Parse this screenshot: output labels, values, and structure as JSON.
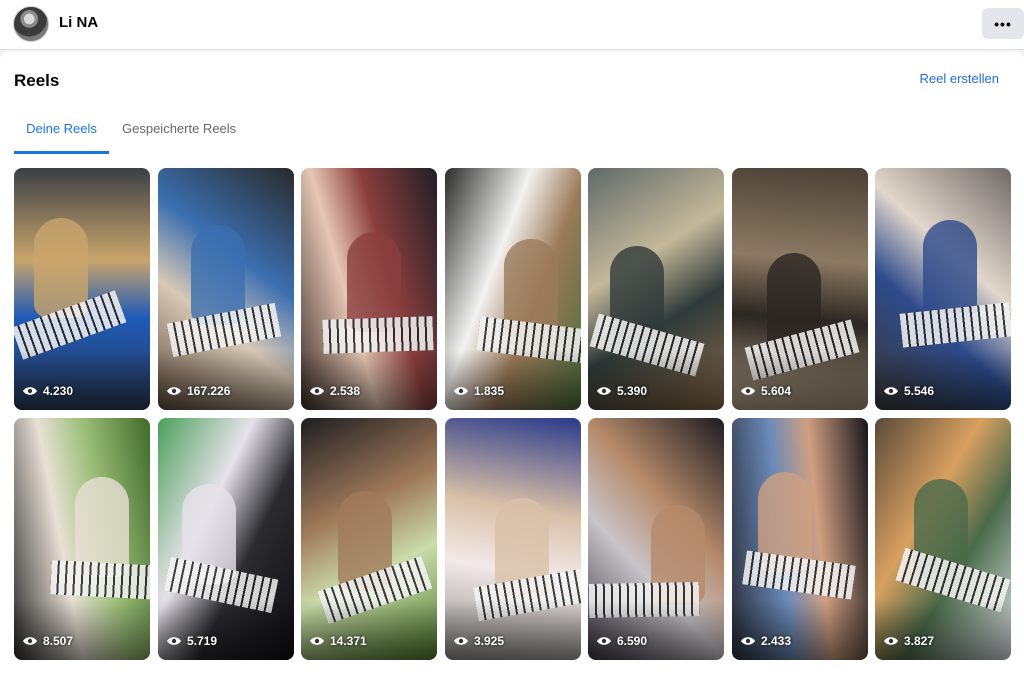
{
  "header": {
    "user_name": "Li NA",
    "more_icon": "more-horizontal-icon",
    "more_label": "•••"
  },
  "section": {
    "title": "Reels",
    "create_link": "Reel erstellen"
  },
  "tabs": [
    {
      "label": "Deine Reels",
      "active": true
    },
    {
      "label": "Gespeicherte Reels",
      "active": false
    }
  ],
  "reels": [
    {
      "views": "4.230",
      "colors": [
        "#2b3a55",
        "#1e5ab8",
        "#c9a56b",
        "#3b3f46"
      ]
    },
    {
      "views": "167.226",
      "colors": [
        "#5b4a3a",
        "#d8c9b6",
        "#3b6fb0",
        "#2a2a2a"
      ]
    },
    {
      "views": "2.538",
      "colors": [
        "#3c2e2a",
        "#e6c7b5",
        "#8a3e3e",
        "#1f1f26"
      ]
    },
    {
      "views": "1.835",
      "colors": [
        "#2b2b2b",
        "#f2f2f0",
        "#9b7b5a",
        "#4a6b3a"
      ]
    },
    {
      "views": "5.390",
      "colors": [
        "#5f6a6a",
        "#c4b89a",
        "#2f3a3a",
        "#8a6c4a"
      ]
    },
    {
      "views": "5.604",
      "colors": [
        "#4a4036",
        "#8c7a63",
        "#2a2622",
        "#b7a48a"
      ]
    },
    {
      "views": "5.546",
      "colors": [
        "#6f6a66",
        "#e2d7cc",
        "#2d4a8a",
        "#3c3a38"
      ]
    },
    {
      "views": "8.507",
      "colors": [
        "#3f6a2a",
        "#9ec07a",
        "#e8e0d6",
        "#2a2a2a"
      ]
    },
    {
      "views": "5.719",
      "colors": [
        "#0e0e10",
        "#2b2b30",
        "#e6e2ea",
        "#4aa05a"
      ]
    },
    {
      "views": "14.371",
      "colors": [
        "#4f7a2f",
        "#c9dca9",
        "#a07a5a",
        "#1e1e22"
      ]
    },
    {
      "views": "3.925",
      "colors": [
        "#8a8a86",
        "#f3e9e9",
        "#d8c0a8",
        "#2a3a8a"
      ]
    },
    {
      "views": "6.590",
      "colors": [
        "#3a3440",
        "#c8c4c8",
        "#b58a6a",
        "#1c1c22"
      ]
    },
    {
      "views": "2.433",
      "colors": [
        "#2a2e3a",
        "#6a8ab8",
        "#d0a080",
        "#16161c"
      ]
    },
    {
      "views": "3.827",
      "colors": [
        "#5a4a3a",
        "#d8a060",
        "#4a6a4a",
        "#e0e4ea"
      ]
    }
  ]
}
